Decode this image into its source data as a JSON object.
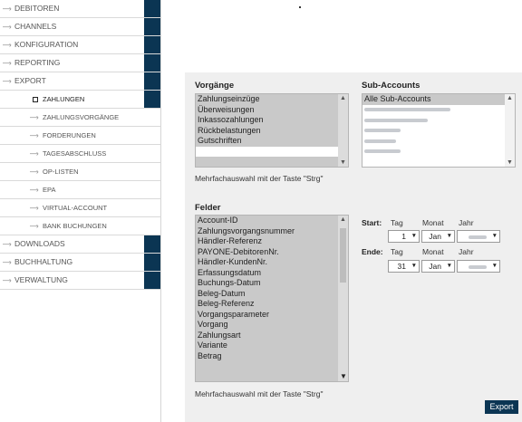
{
  "sidebar": {
    "items": [
      {
        "label": "DEBITOREN"
      },
      {
        "label": "CHANNELS"
      },
      {
        "label": "KONFIGURATION"
      },
      {
        "label": "REPORTING"
      },
      {
        "label": "EXPORT"
      },
      {
        "label": "ZAHLUNGEN"
      },
      {
        "label": "ZAHLUNGSVORGÄNGE"
      },
      {
        "label": "FORDERUNGEN"
      },
      {
        "label": "TAGESABSCHLUSS"
      },
      {
        "label": "OP-LISTEN"
      },
      {
        "label": "EPA"
      },
      {
        "label": "VIRTUAL-ACCOUNT"
      },
      {
        "label": "BANK BUCHUNGEN"
      },
      {
        "label": "DOWNLOADS"
      },
      {
        "label": "BUCHHALTUNG"
      },
      {
        "label": "VERWALTUNG"
      }
    ]
  },
  "vorgaenge": {
    "title": "Vorgänge",
    "options": [
      "Zahlungseinzüge",
      "Überweisungen",
      "Inkassozahlungen",
      "Rückbelastungen",
      "Gutschriften"
    ],
    "hint": "Mehrfachauswahl mit der Taste \"Strg\""
  },
  "subaccounts": {
    "title": "Sub-Accounts",
    "first_option": "Alle Sub-Accounts"
  },
  "felder": {
    "title": "Felder",
    "options": [
      "Account-ID",
      "Zahlungsvorgangsnummer",
      "Händler-Referenz",
      "PAYONE-DebitorenNr.",
      "Händler-KundenNr.",
      "Erfassungsdatum",
      "Buchungs-Datum",
      "Beleg-Datum",
      "Beleg-Referenz",
      "Vorgangsparameter",
      "Vorgang",
      "Zahlungsart",
      "Variante",
      "Betrag"
    ],
    "hint": "Mehrfachauswahl mit der Taste \"Strg\""
  },
  "date": {
    "start_label": "Start:",
    "end_label": "Ende:",
    "col_tag": "Tag",
    "col_monat": "Monat",
    "col_jahr": "Jahr",
    "start_day": "1",
    "start_month": "Jan",
    "end_day": "31",
    "end_month": "Jan"
  },
  "export_label": "Export",
  "icons": {
    "arrow": "arrow-right-icon",
    "scroll_up": "chevron-up-icon",
    "scroll_down": "chevron-down-icon",
    "caret": "caret-down-icon"
  },
  "colors": {
    "accent": "#0b3553",
    "listbox": "#c9c9c9",
    "panel": "#efefef"
  }
}
